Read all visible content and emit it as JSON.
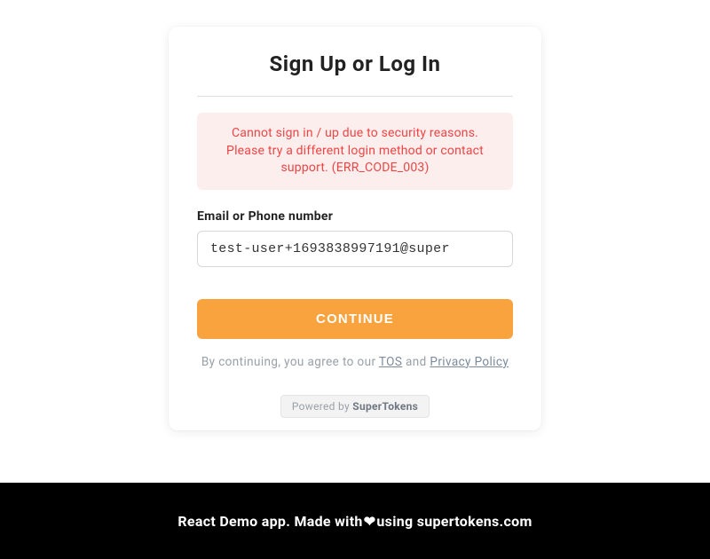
{
  "card": {
    "title": "Sign Up or Log In",
    "error": "Cannot sign in / up due to security reasons. Please try a different login method or contact support. (ERR_CODE_003)",
    "field_label": "Email or Phone number",
    "input_value": "test-user+1693838997191@super",
    "continue_label": "CONTINUE",
    "legal_prefix": "By continuing, you agree to our ",
    "tos_label": "TOS",
    "legal_and": " and ",
    "privacy_label": "Privacy Policy",
    "powered_prefix": "Powered by ",
    "powered_brand": "SuperTokens"
  },
  "footer": {
    "text_before": "React Demo app. Made with",
    "heart": "❤",
    "text_after": "using supertokens.com"
  }
}
